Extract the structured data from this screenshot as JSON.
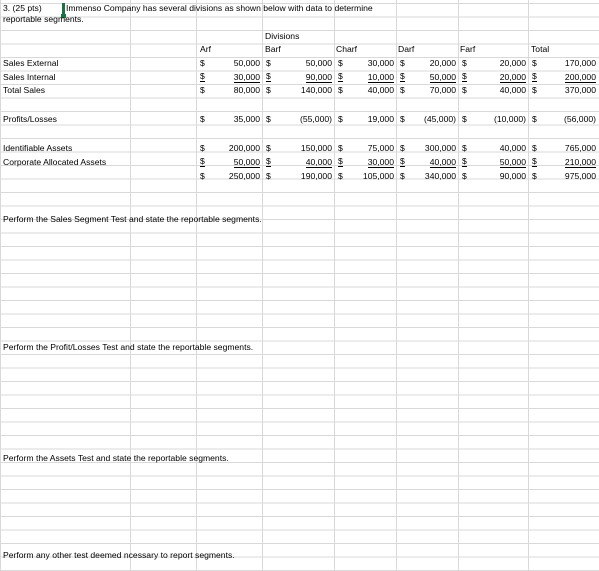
{
  "problem": {
    "prefix": "3.  (25 pts)",
    "text": "Immenso Company has several divisions as shown below with data to determine",
    "line2": "reportable segments."
  },
  "header": {
    "group": "Divisions",
    "columns": [
      "Arf",
      "Barf",
      "Charf",
      "Darf",
      "Farf",
      "Total"
    ]
  },
  "currency": "$",
  "rows": [
    {
      "label": "Sales External",
      "values": [
        "50,000",
        "50,000",
        "30,000",
        "20,000",
        "20,000",
        "170,000"
      ]
    },
    {
      "label": "Sales Internal",
      "values": [
        "30,000",
        "90,000",
        "10,000",
        "50,000",
        "20,000",
        "200,000"
      ]
    },
    {
      "label": "Total Sales",
      "values": [
        "80,000",
        "140,000",
        "40,000",
        "70,000",
        "40,000",
        "370,000"
      ]
    },
    {
      "label": "Profits/Losses",
      "values": [
        "35,000",
        "(55,000)",
        "19,000",
        "(45,000)",
        "(10,000)",
        "(56,000)"
      ]
    },
    {
      "label": "Identifiable Assets",
      "values": [
        "200,000",
        "150,000",
        "75,000",
        "300,000",
        "40,000",
        "765,000"
      ]
    },
    {
      "label": "Corporate Allocated Assets",
      "values": [
        "50,000",
        "40,000",
        "30,000",
        "40,000",
        "50,000",
        "210,000"
      ]
    },
    {
      "label": "",
      "values": [
        "250,000",
        "190,000",
        "105,000",
        "340,000",
        "90,000",
        "975,000"
      ]
    }
  ],
  "prompts": [
    "Perform the Sales Segment Test and state the reportable segments.",
    "Perform the Profit/Losses Test and state the reportable segments.",
    "Perform the Assets Test and state the reportable segments.",
    "Perform any other test deemed ncessary to report segments."
  ]
}
